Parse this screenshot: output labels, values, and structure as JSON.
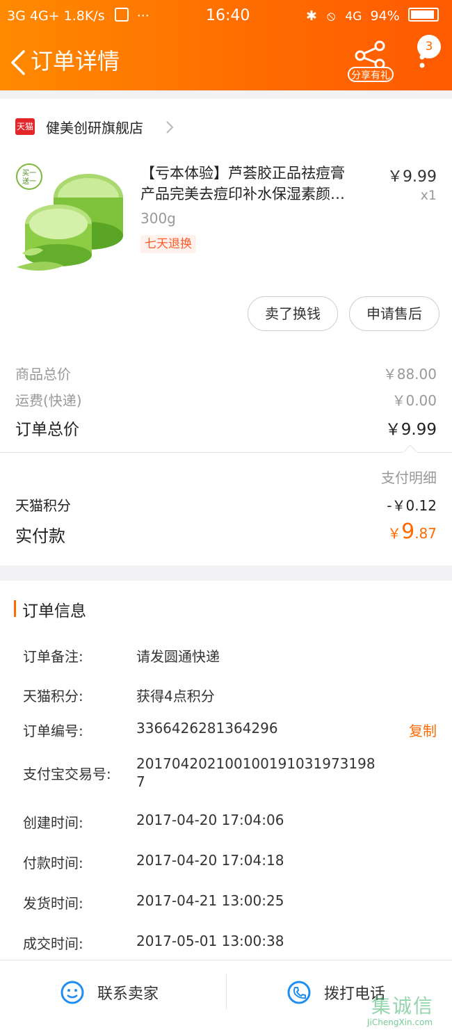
{
  "status": {
    "left": "3G  4G+  1.8K/s",
    "time": "16:40",
    "network": "4G",
    "battery": "94%"
  },
  "header": {
    "title": "订单详情",
    "share_label": "分享有礼",
    "badge": "3"
  },
  "shop": {
    "badge": "天猫",
    "name": "健美创研旗舰店"
  },
  "product": {
    "title_line1": "【亏本体验】芦荟胶正品祛痘膏",
    "title_line2": "产品完美去痘印补水保湿素颜…",
    "spec": "300g",
    "tag": "七天退换",
    "price": "￥9.99",
    "qty": "x1",
    "image_label": "芦荟胶产品图",
    "image_badge": "买一送一"
  },
  "actions": {
    "sell": "卖了换钱",
    "after_sale": "申请售后"
  },
  "price_summary": {
    "goods_label": "商品总价",
    "goods_value": "￥88.00",
    "shipping_label": "运费(快递)",
    "shipping_value": "￥0.00",
    "total_label": "订单总价",
    "total_value": "￥9.99"
  },
  "payment": {
    "detail_link": "支付明细",
    "points_label": "天猫积分",
    "points_value": "-￥0.12",
    "paid_label": "实付款",
    "paid_currency": "￥",
    "paid_int": "9",
    "paid_dec": ".87"
  },
  "order_info": {
    "title": "订单信息",
    "rows": [
      {
        "label": "订单备注:",
        "value": "请发圆通快递"
      },
      {
        "label": "天猫积分:",
        "value": "获得4点积分"
      },
      {
        "label": "订单编号:",
        "value": "3366426281364296"
      },
      {
        "label": "支付宝交易号:",
        "value": "201704202100100191031973198",
        "value2": "7"
      },
      {
        "label": "创建时间:",
        "value": "2017-04-20 17:04:06"
      },
      {
        "label": "付款时间:",
        "value": "2017-04-20 17:04:18"
      },
      {
        "label": "发货时间:",
        "value": "2017-04-21 13:00:25"
      },
      {
        "label": "成交时间:",
        "value": "2017-05-01 13:00:38"
      }
    ],
    "copy": "复制"
  },
  "bottom_bar": {
    "contact": "联系卖家",
    "call": "拨打电话"
  },
  "watermark": {
    "brand": "集诚信",
    "url": "JiChengXin.com"
  },
  "colors": {
    "accent": "#ff6a00",
    "tmall_red": "#e4262b",
    "blue_icon": "#1f8ef1"
  }
}
